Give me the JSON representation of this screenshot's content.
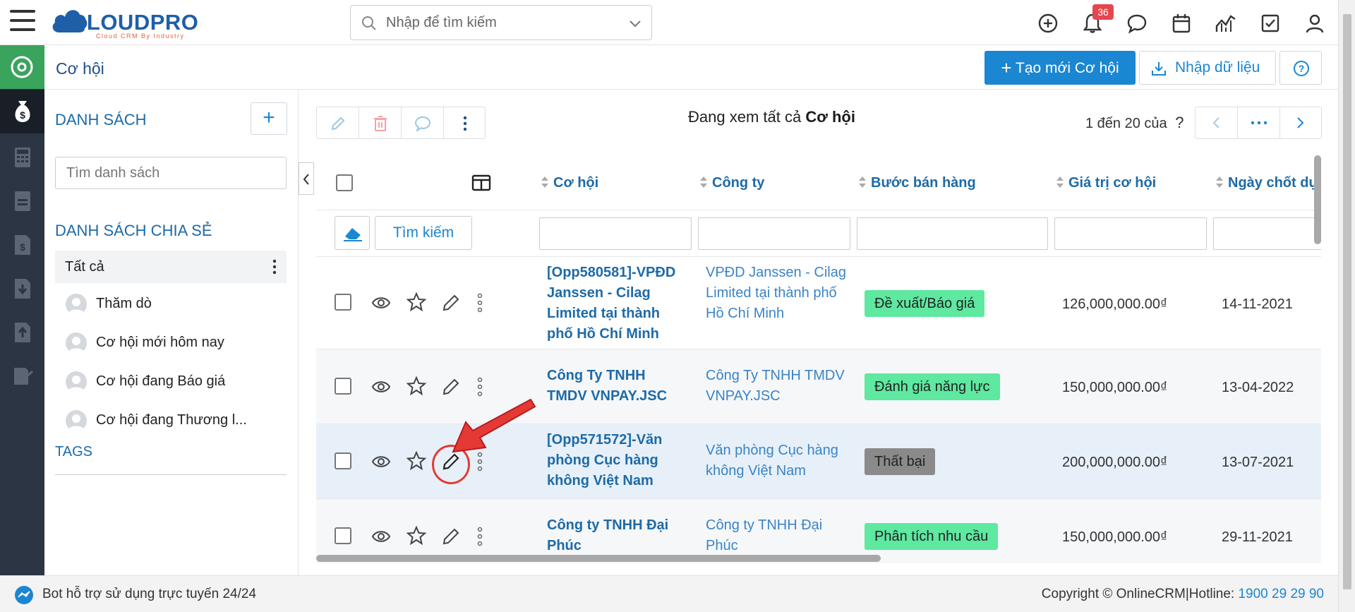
{
  "topbar": {
    "logo_text": "CLOUDPRO",
    "logo_sub": "Cloud CRM By Industry",
    "search_placeholder": "Nhập để tìm kiếm",
    "notification_count": "36"
  },
  "titlebar": {
    "page_title": "Cơ hội",
    "create_button": "Tạo mới Cơ hội",
    "import_button": "Nhập dữ liệu"
  },
  "sidebar": {
    "lists_heading": "DANH SÁCH",
    "search_placeholder": "Tìm danh sách",
    "shared_heading": "DANH SÁCH CHIA SẺ",
    "all_item": "Tất cả",
    "items": [
      "Thăm dò",
      "Cơ hội mới hôm nay",
      "Cơ hội đang Báo giá",
      "Cơ hội đang Thương l..."
    ],
    "tags_heading": "TAGS"
  },
  "main": {
    "viewing_prefix": "Đang xem tất cả",
    "viewing_module": "Cơ hội",
    "pager_text": "1 đến 20 của",
    "pager_unknown": "?",
    "search_button": "Tìm kiếm"
  },
  "table": {
    "columns": [
      "Cơ hội",
      "Công ty",
      "Bước bán hàng",
      "Giá trị cơ hội",
      "Ngày chốt dự"
    ],
    "rows": [
      {
        "opportunity": "[Opp580581]-VPĐD Janssen - Cilag Limited tại thành phố Hồ Chí Minh",
        "company": "VPĐD Janssen - Cilag Limited tại thành phố Hồ Chí Minh",
        "stage": "Đề xuất/Báo giá",
        "stage_color": "#5ee8a0",
        "value": "126,000,000.00₫",
        "date": "14-11-2021"
      },
      {
        "opportunity": "Công Ty TNHH TMDV VNPAY.JSC",
        "company": "Công Ty TNHH TMDV VNPAY.JSC",
        "stage": "Đánh giá năng lực",
        "stage_color": "#5ee8a0",
        "value": "150,000,000.00₫",
        "date": "13-04-2022"
      },
      {
        "opportunity": "[Opp571572]-Văn phòng Cục hàng không Việt Nam",
        "company": "Văn phòng Cục hàng không Việt Nam",
        "stage": "Thất bại",
        "stage_color": "#8a8a8a",
        "value": "200,000,000.00₫",
        "date": "13-07-2021"
      },
      {
        "opportunity": "Công ty TNHH Đại Phúc",
        "company": "Công ty TNHH Đại Phúc",
        "stage": "Phân tích nhu cầu",
        "stage_color": "#5ee8a0",
        "value": "150,000,000.00₫",
        "date": "29-11-2021"
      }
    ]
  },
  "footer": {
    "bot_text": "Bot hỗ trợ sử dụng trực tuyến 24/24",
    "copyright": "Copyright © OnlineCRM|Hotline:",
    "hotline": "1900 29 29 90"
  }
}
